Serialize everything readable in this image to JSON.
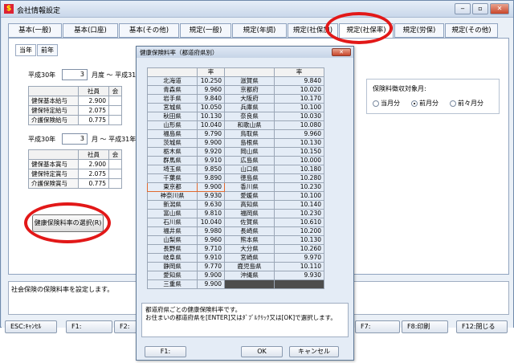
{
  "window": {
    "title": "会社情報設定",
    "buttons": [
      "‒",
      "▫",
      "✕"
    ]
  },
  "tabs": [
    "基本(一般)",
    "基本(口座)",
    "基本(その他)",
    "規定(一般)",
    "規定(年調)",
    "規定(社保加)",
    "規定(社保率)",
    "規定(労保)",
    "規定(その他)"
  ],
  "active_tab": 6,
  "subtabs": [
    "当年",
    "前年"
  ],
  "sec1": {
    "era": "平成30年",
    "month": "3",
    "month_suffix": "月度 〜 平成31"
  },
  "sec2": {
    "era": "平成30年",
    "month": "3",
    "month_suffix": "月 〜 平成31年"
  },
  "rates_table1": {
    "headers": [
      "",
      "社員",
      "会"
    ],
    "rows": [
      [
        "健保基本給与",
        "2.900",
        ""
      ],
      [
        "健保特定給与",
        "2.075",
        ""
      ],
      [
        "介護保険給与",
        "0.775",
        ""
      ]
    ]
  },
  "rates_table2": {
    "headers": [
      "",
      "社員",
      "会"
    ],
    "rows": [
      [
        "健保基本賞与",
        "2.900",
        ""
      ],
      [
        "健保特定賞与",
        "2.075",
        ""
      ],
      [
        "介護保険賞与",
        "0.775",
        ""
      ]
    ]
  },
  "select_button": "健康保険料率の選択(R)",
  "collection": {
    "label": "保険料徴収対象月:",
    "options": [
      "当月分",
      "前月分",
      "前々月分"
    ],
    "selected": 1
  },
  "status_text": "社会保険の保険料率を設定します。",
  "fkeys": [
    "ESC:ｷｬﾝｾﾙ",
    "F1:",
    "F2:",
    "F7:",
    "F8:印刷",
    "F12:閉じる"
  ],
  "dialog": {
    "title": "健康保険料率（都道府県別）",
    "header": "率",
    "rows": [
      [
        "北海道",
        "10.250",
        "滋賀県",
        "9.840"
      ],
      [
        "青森県",
        "9.960",
        "京都府",
        "10.020"
      ],
      [
        "岩手県",
        "9.840",
        "大阪府",
        "10.170"
      ],
      [
        "宮城県",
        "10.050",
        "兵庫県",
        "10.100"
      ],
      [
        "秋田県",
        "10.130",
        "奈良県",
        "10.030"
      ],
      [
        "山形県",
        "10.040",
        "和歌山県",
        "10.080"
      ],
      [
        "福島県",
        "9.790",
        "鳥取県",
        "9.960"
      ],
      [
        "茨城県",
        "9.900",
        "島根県",
        "10.130"
      ],
      [
        "栃木県",
        "9.920",
        "岡山県",
        "10.150"
      ],
      [
        "群馬県",
        "9.910",
        "広島県",
        "10.000"
      ],
      [
        "埼玉県",
        "9.850",
        "山口県",
        "10.180"
      ],
      [
        "千葉県",
        "9.890",
        "徳島県",
        "10.280"
      ],
      [
        "東京都",
        "9.900",
        "香川県",
        "10.230"
      ],
      [
        "神奈川県",
        "9.930",
        "愛媛県",
        "10.100"
      ],
      [
        "新潟県",
        "9.630",
        "高知県",
        "10.140"
      ],
      [
        "富山県",
        "9.810",
        "福岡県",
        "10.230"
      ],
      [
        "石川県",
        "10.040",
        "佐賀県",
        "10.610"
      ],
      [
        "福井県",
        "9.980",
        "長崎県",
        "10.200"
      ],
      [
        "山梨県",
        "9.960",
        "熊本県",
        "10.130"
      ],
      [
        "長野県",
        "9.710",
        "大分県",
        "10.260"
      ],
      [
        "岐阜県",
        "9.910",
        "宮崎県",
        "9.970"
      ],
      [
        "静岡県",
        "9.770",
        "鹿児島県",
        "10.110"
      ],
      [
        "愛知県",
        "9.900",
        "沖縄県",
        "9.930"
      ],
      [
        "三重県",
        "9.900",
        "",
        ""
      ]
    ],
    "selected_row": 12,
    "message": "都道府県ごとの健康保険料率です。\nお住まいの都道府県を[ENTER]又はﾀﾞﾌﾞﾙｸﾘｯｸ又は[OK]で選択します。",
    "buttons": {
      "f1": "F1:",
      "ok": "OK",
      "cancel": "キャンセル"
    }
  }
}
